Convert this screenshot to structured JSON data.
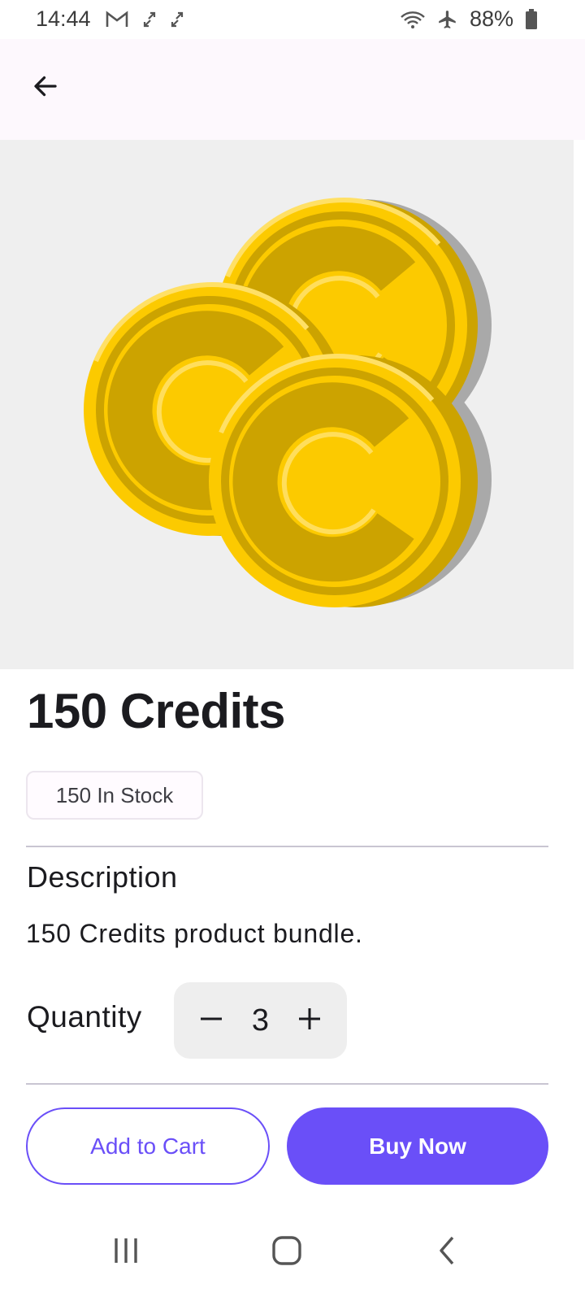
{
  "status_bar": {
    "time": "14:44",
    "battery": "88%",
    "icons": [
      "gmail-icon",
      "sync-icon",
      "sync-icon",
      "wifi-icon",
      "airplane-icon",
      "battery-icon"
    ]
  },
  "app_bar": {
    "back_icon": "arrow-back-icon"
  },
  "product": {
    "image_icon": "coins-icon",
    "title": "150 Credits",
    "stock": "150 In Stock",
    "description_heading": "Description",
    "description": "150 Credits product bundle.",
    "quantity_label": "Quantity",
    "quantity_value": "3",
    "decrement_symbol": "–",
    "increment_symbol": "+"
  },
  "actions": {
    "add_to_cart": "Add to Cart",
    "buy_now": "Buy Now"
  },
  "colors": {
    "accent": "#6a4ff8",
    "coin": "#fcca00",
    "coin_dark": "#cca300",
    "image_bg": "#efefef",
    "app_bar_bg": "#fdf8fd"
  },
  "nav_bar": {
    "icons": [
      "recent-apps-icon",
      "home-icon",
      "back-icon"
    ]
  }
}
